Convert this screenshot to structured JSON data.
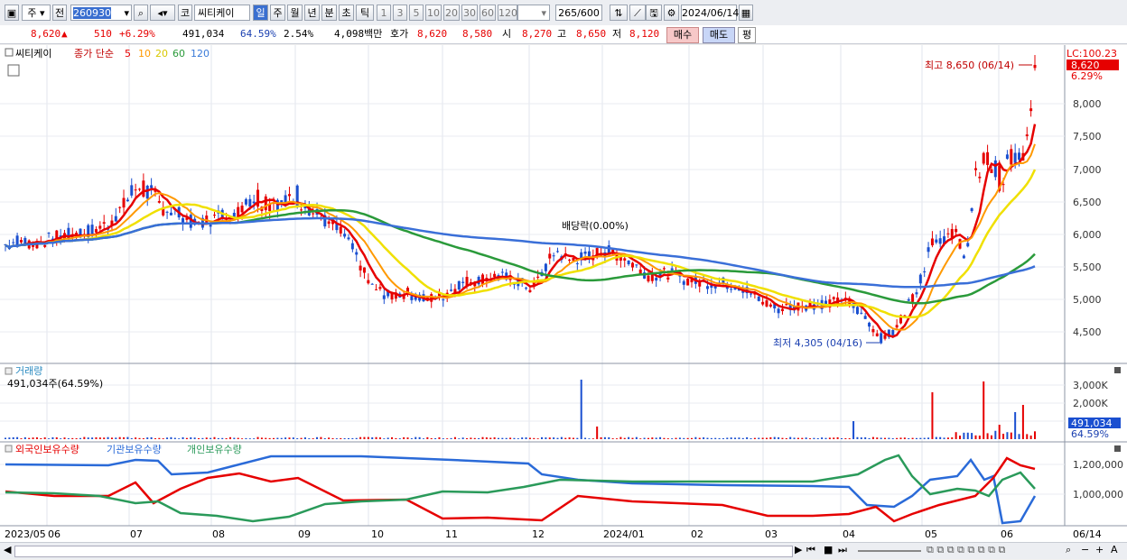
{
  "toolbar": {
    "market_label": "주",
    "prev_label": "전",
    "code": "260930",
    "kor_label": "코",
    "stock_name": "씨티케이",
    "period_tabs": [
      "일",
      "주",
      "월",
      "년",
      "분",
      "초",
      "틱"
    ],
    "minute_options": [
      "1",
      "3",
      "5",
      "10",
      "20",
      "30",
      "60",
      "120"
    ],
    "count_value": "265",
    "count_total": "/600",
    "date": "2024/06/14"
  },
  "quote": {
    "price": "8,620",
    "direction": "▲",
    "change": "510",
    "change_pct": "+6.29%",
    "volume": "491,034",
    "ratio": "64.59%",
    "turnover": "2.54%",
    "amount": "4,098백만",
    "ask_label": "호가",
    "ask": "8,620",
    "bid": "8,580",
    "open_label": "시",
    "open": "8,270",
    "high_label": "고",
    "high": "8,650",
    "low_label": "저",
    "low": "8,120",
    "buy_label": "매수",
    "sell_label": "매도",
    "flat_label": "평"
  },
  "price_panel": {
    "name": "씨티케이",
    "legend_prefix": "종가 단순",
    "ma_legend": [
      {
        "label": "5",
        "color": "#e60000"
      },
      {
        "label": "10",
        "color": "#ff9900"
      },
      {
        "label": "20",
        "color": "#e8d800"
      },
      {
        "label": "60",
        "color": "#2a9a3a"
      },
      {
        "label": "120",
        "color": "#3a7ad8"
      }
    ],
    "lc_label": "LC:100.23",
    "price_tag": "8,620",
    "pct_tag": "6.29%",
    "high_note": "최고 8,650 (06/14)",
    "low_note": "최저 4,305 (04/16)",
    "dividend_note": "배당락(0.00%)",
    "y_ticks": [
      "8,000",
      "7,500",
      "7,000",
      "6,500",
      "6,000",
      "5,500",
      "5,000",
      "4,500"
    ]
  },
  "volume_panel": {
    "title": "거래량",
    "value_text": "491,034주(64.59%)",
    "y_ticks": [
      "3,000K",
      "2,000K",
      "1,000K"
    ],
    "tag_value": "491,034",
    "tag_pct": "64.59%"
  },
  "holdings_panel": {
    "legend": [
      {
        "label": "외국인보유수량",
        "color": "#e60000"
      },
      {
        "label": "기관보유수량",
        "color": "#2a6ad8"
      },
      {
        "label": "개인보유수량",
        "color": "#2a9a5a"
      }
    ],
    "y_ticks": [
      "1,200,000",
      "1,000,000"
    ]
  },
  "x_axis": {
    "labels": [
      "2023/05",
      "06",
      "07",
      "08",
      "09",
      "10",
      "11",
      "12",
      "2024/01",
      "02",
      "03",
      "04",
      "05",
      "06",
      "06/14"
    ]
  },
  "colors": {
    "up": "#e60000",
    "down": "#1a4fd0",
    "ma5": "#e60000",
    "ma10": "#ff9900",
    "ma20": "#f0e000",
    "ma60": "#2a9a3a",
    "ma120": "#3a6fd8"
  }
}
